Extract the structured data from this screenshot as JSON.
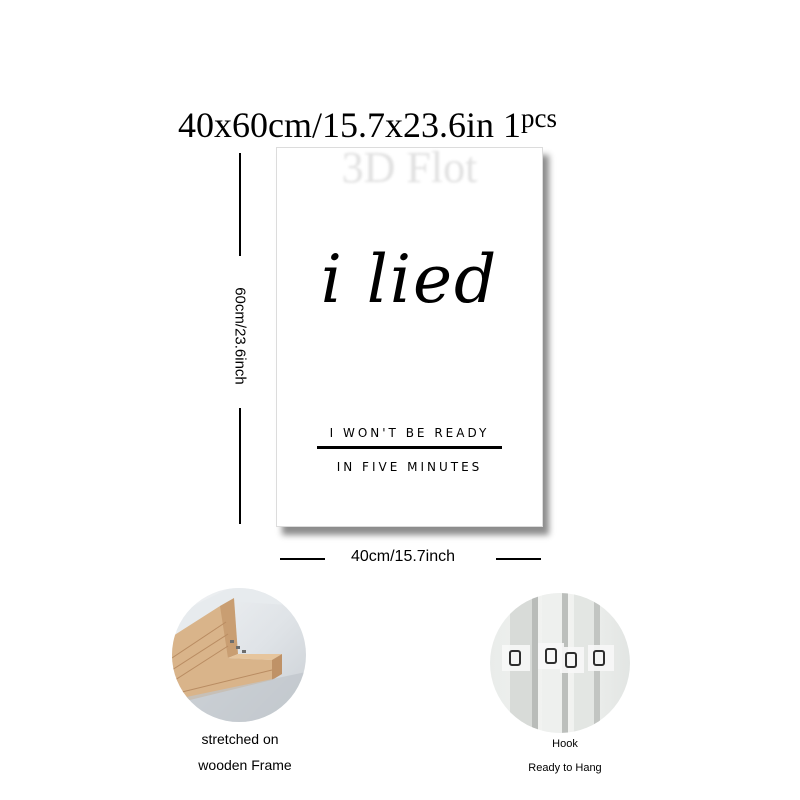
{
  "headline": {
    "size": "40x60cm/15.7x23.6in",
    "quantity": "1",
    "unit": "pcs"
  },
  "poster": {
    "watermark": "3D Flot",
    "title": "i lied",
    "line1": "I WON'T BE READY",
    "line2": "IN FIVE MINUTES"
  },
  "dimensions": {
    "height_label": "60cm/23.6inch",
    "width_label": "40cm/15.7inch"
  },
  "features": {
    "frame": {
      "icon": "wooden-frame-corner-photo",
      "caption_line1": "stretched on",
      "caption_line2": "wooden Frame"
    },
    "hook": {
      "icon": "hanging-hook-photo",
      "caption_line1": "Hook",
      "caption_line2": "Ready to Hang"
    }
  },
  "colors": {
    "wood": "#d9b48a",
    "shadow": "#555555"
  }
}
